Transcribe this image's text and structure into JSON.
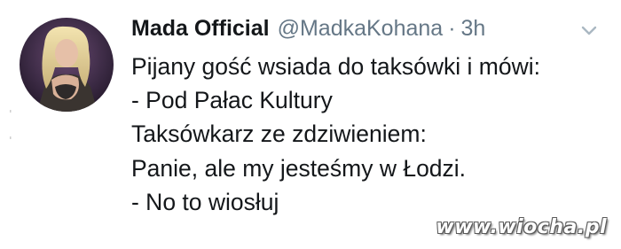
{
  "tweet": {
    "display_name": "Mada Official",
    "handle": "@MadkaKohana",
    "separator": "·",
    "time": "3h",
    "lines": [
      "Pijany gość wsiada do taksówki i mówi:",
      "- Pod Pałac Kultury",
      "Taksówkarz ze zdziwieniem:",
      "Panie, ale my jesteśmy w Łodzi.",
      "- No to wiosłuj"
    ]
  },
  "icons": {
    "avatar": "profile-avatar",
    "menu": "chevron-down-icon"
  },
  "watermark": {
    "text": "www.wiocha.pl"
  },
  "colors": {
    "text": "#14171a",
    "secondary": "#657786",
    "background": "#ffffff"
  }
}
